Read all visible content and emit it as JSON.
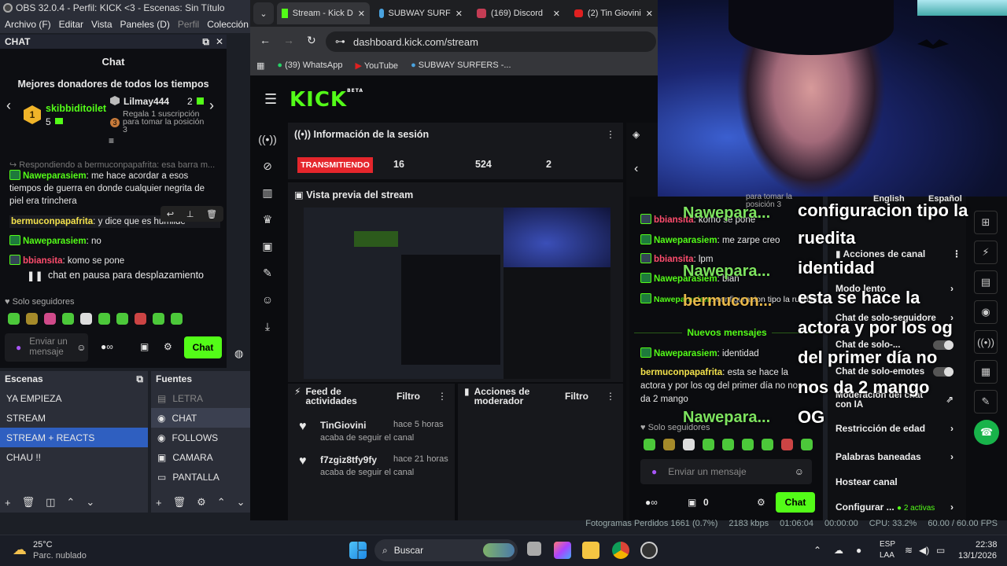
{
  "obs": {
    "title": "OBS 32.0.4 - Perfil: KICK <3 - Escenas: Sin Título",
    "menu": [
      "Archivo (F)",
      "Editar",
      "Vista",
      "Paneles (D)",
      "Perfil",
      "Colección d"
    ],
    "chat_dock_title": "CHAT",
    "scenes_title": "Escenas",
    "sources_title": "Fuentes",
    "scenes": [
      "YA EMPIEZA",
      "STREAM",
      "STREAM + REACTS",
      "CHAU !!"
    ],
    "selected_scene": "STREAM + REACTS",
    "sources": [
      "LETRA",
      "CHAT",
      "FOLLOWS",
      "CAMARA",
      "PANTALLA"
    ],
    "selected_source": "CHAT",
    "status": {
      "dropped": "Fotogramas Perdidos 1661 (0.7%)",
      "bitrate": "2183 kbps",
      "time": "01:06:04",
      "rec": "00:00:00",
      "cpu": "CPU: 33.2%",
      "fps": "60.00 / 60.00 FPS"
    }
  },
  "chat": {
    "title": "Chat",
    "donors_title": "Mejores donadores de todos los tiempos",
    "donor1_name": "skibbiditoilet",
    "donor1_rank": "1",
    "donor1_count": "5",
    "donor2_name": "Lilmay444",
    "donor2_count": "2",
    "donor3_rank": "3",
    "donor3_text": "Regala 1 suscripción para tomar la posición 3",
    "reply_ref": "Respondiendo a bermuconpapafrita: esa barra m...",
    "messages": [
      {
        "user": "Naweparasiem",
        "text": "me hace acordar a esos tiempos de guerra en donde cualquier negrita de piel era trinchera"
      },
      {
        "user": "bermuconpapafrita",
        "text": "y dice que es humilde"
      },
      {
        "user": "Naweparasiem",
        "text": "no"
      },
      {
        "user": "bbiansita",
        "text": "komo se pone"
      }
    ],
    "pause_text": "chat en pausa para desplazamiento",
    "followers_only": "Solo seguidores",
    "input_placeholder": "Enviar un mensaje",
    "send_label": "Chat"
  },
  "browser": {
    "tabs": [
      "Stream - Kick D",
      "SUBWAY SURF",
      "(169) Discord",
      "(2) Tin Giovini"
    ],
    "url": "dashboard.kick.com/stream",
    "bookmarks": [
      "(39) WhatsApp",
      "YouTube",
      "SUBWAY SURFERS -..."
    ]
  },
  "kick": {
    "logo": "KICK",
    "logo_sup": "BETA",
    "session_title": "Información de la sesión",
    "live_label": "TRANSMITIENDO",
    "stats": [
      "16",
      "524",
      "2"
    ],
    "preview_title": "Vista previa del stream",
    "feed_title": "Feed de actividades",
    "feed_filter": "Filtro",
    "mods_title": "Acciones de moderador",
    "mods_filter": "Filtro",
    "feed_items": [
      {
        "name": "TinGiovini",
        "time": "hace 5 horas",
        "action": "acaba de seguir el canal"
      },
      {
        "name": "f7zgiz8tfy9fy",
        "time": "hace 21 horas",
        "action": "acaba de seguir el canal"
      }
    ]
  },
  "kchat": {
    "position_hint": "para tomar la posición 3",
    "messages": [
      {
        "user": "bbiansita",
        "text": "komo se pone"
      },
      {
        "user": "Naweparasiem",
        "text": "me zarpe creo"
      },
      {
        "user": "bbiansita",
        "text": "lpm"
      },
      {
        "user": "Naweparasiem",
        "text": "bian"
      },
      {
        "user": "Naweparasiem",
        "text": "configuracion tipo la ruedita"
      }
    ],
    "new_messages": "Nuevos mensajes",
    "after_messages": [
      {
        "user": "Naweparasiem",
        "text": "identidad"
      },
      {
        "user": "bermuconpapafrita",
        "text": "esta se hace la actora y por los og del primer día no nos da 2 mango"
      }
    ],
    "followers_only": "Solo seguidores",
    "input_placeholder": "Enviar un mensaje",
    "count": "0",
    "send_label": "Chat"
  },
  "overlay": {
    "lines": [
      "configuracion tipo la",
      "ruedita",
      "identidad",
      "esta se hace la",
      "actora y por los og",
      "del primer día no",
      "nos da 2 mango",
      "OG"
    ],
    "names": [
      "Nawepara...",
      "Nawepara...",
      "bermucon...",
      "Nawepara..."
    ]
  },
  "kmod": {
    "lang_en": "English",
    "lang_es": "Español",
    "title": "Acciones de canal",
    "rows": [
      "Modo lento",
      "Chat de solo-seguidore",
      "Chat de solo-...",
      "Chat de solo-emotes",
      "Moderación del chat con IA",
      "Restricción de edad",
      "Palabras baneadas",
      "Hostear canal"
    ],
    "config_label": "Configurar ...",
    "config_badge": "2 activas"
  },
  "taskbar": {
    "weather_temp": "25°C",
    "weather_desc": "Parc. nublado",
    "search_placeholder": "Buscar",
    "lang": "ESP",
    "lang2": "LAA",
    "time": "22:38",
    "date": "13/1/2026"
  },
  "colors": {
    "kick_green": "#53fc18",
    "live_red": "#e5262c",
    "obs_selection": "#2f5fc0"
  }
}
